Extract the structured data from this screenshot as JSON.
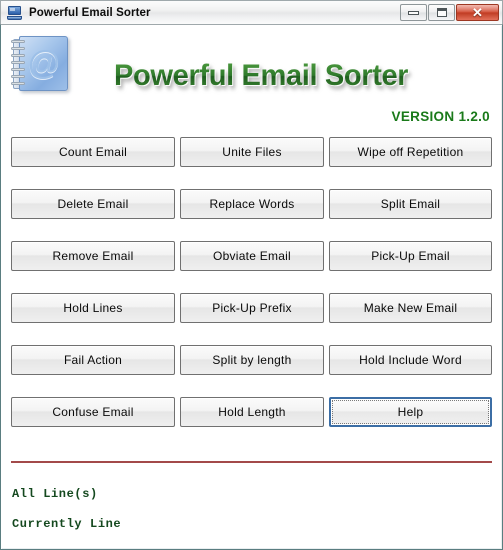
{
  "window": {
    "title": "Powerful Email Sorter",
    "icon": "computer-monitor-icon",
    "controls": {
      "minimize_label": "–",
      "maximize_label": "□",
      "close_label": "✕"
    }
  },
  "banner": {
    "logo_icon": "address-book-at-icon",
    "logo_glyph": "@",
    "app_title": "Powerful Email Sorter",
    "version": "VERSION 1.2.0",
    "title_color": "#2f7a2c",
    "version_color": "#1a7a1a"
  },
  "buttons": [
    {
      "label": "Count Email",
      "focused": false
    },
    {
      "label": "Unite Files",
      "focused": false
    },
    {
      "label": "Wipe off Repetition",
      "focused": false
    },
    {
      "label": "Delete Email",
      "focused": false
    },
    {
      "label": "Replace Words",
      "focused": false
    },
    {
      "label": "Split Email",
      "focused": false
    },
    {
      "label": "Remove Email",
      "focused": false
    },
    {
      "label": "Obviate Email",
      "focused": false
    },
    {
      "label": "Pick-Up Email",
      "focused": false
    },
    {
      "label": "Hold Lines",
      "focused": false
    },
    {
      "label": "Pick-Up Prefix",
      "focused": false
    },
    {
      "label": "Make New Email",
      "focused": false
    },
    {
      "label": "Fail Action",
      "focused": false
    },
    {
      "label": "Split by length",
      "focused": false
    },
    {
      "label": "Hold Include Word",
      "focused": false
    },
    {
      "label": "Confuse Email",
      "focused": false
    },
    {
      "label": "Hold Length",
      "focused": false
    },
    {
      "label": "Help",
      "focused": true
    }
  ],
  "separator_color": "#a34a4a",
  "status": {
    "all_lines": "All Line(s)",
    "currently_line": "Currently Line",
    "color": "#15491f"
  }
}
